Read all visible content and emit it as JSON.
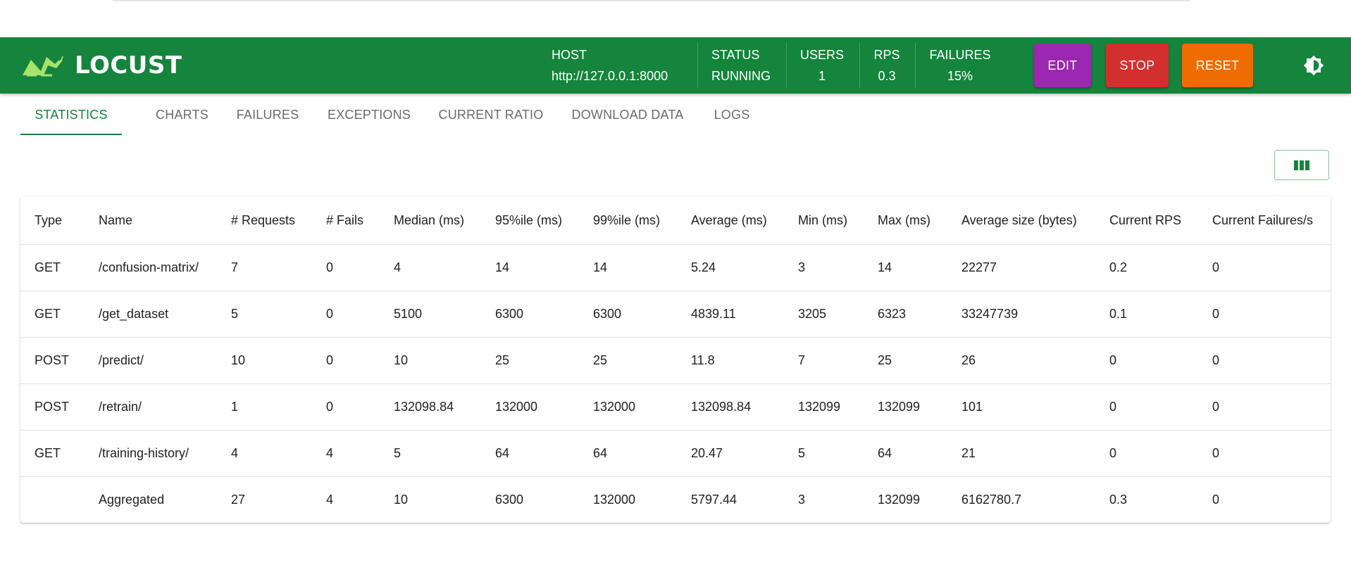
{
  "app": {
    "logo_text": "LOCUST",
    "brand_color": "#15843c"
  },
  "header": {
    "host_label": "HOST",
    "host_value": "http://127.0.0.1:8000",
    "status_label": "STATUS",
    "status_value": "RUNNING",
    "users_label": "USERS",
    "users_value": "1",
    "rps_label": "RPS",
    "rps_value": "0.3",
    "failures_label": "FAILURES",
    "failures_value": "15%",
    "edit_label": "EDIT",
    "stop_label": "STOP",
    "reset_label": "RESET",
    "edit_color": "#9c27b0",
    "stop_color": "#d32f2f",
    "reset_color": "#ef6c00",
    "theme_icon": "brightness-icon"
  },
  "tabs": [
    {
      "label": "STATISTICS",
      "active": true
    },
    {
      "label": "CHARTS"
    },
    {
      "label": "FAILURES"
    },
    {
      "label": "EXCEPTIONS"
    },
    {
      "label": "CURRENT RATIO"
    },
    {
      "label": "DOWNLOAD DATA"
    },
    {
      "label": "LOGS"
    }
  ],
  "toolbar": {
    "columns_icon": "view-column-icon"
  },
  "table": {
    "headers": [
      "Type",
      "Name",
      "# Requests",
      "# Fails",
      "Median (ms)",
      "95%ile (ms)",
      "99%ile (ms)",
      "Average (ms)",
      "Min (ms)",
      "Max (ms)",
      "Average size (bytes)",
      "Current RPS",
      "Current Failures/s"
    ],
    "rows": [
      [
        "GET",
        "/confusion-matrix/",
        "7",
        "0",
        "4",
        "14",
        "14",
        "5.24",
        "3",
        "14",
        "22277",
        "0.2",
        "0"
      ],
      [
        "GET",
        "/get_dataset",
        "5",
        "0",
        "5100",
        "6300",
        "6300",
        "4839.11",
        "3205",
        "6323",
        "33247739",
        "0.1",
        "0"
      ],
      [
        "POST",
        "/predict/",
        "10",
        "0",
        "10",
        "25",
        "25",
        "11.8",
        "7",
        "25",
        "26",
        "0",
        "0"
      ],
      [
        "POST",
        "/retrain/",
        "1",
        "0",
        "132098.84",
        "132000",
        "132000",
        "132098.84",
        "132099",
        "132099",
        "101",
        "0",
        "0"
      ],
      [
        "GET",
        "/training-history/",
        "4",
        "4",
        "5",
        "64",
        "64",
        "20.47",
        "5",
        "64",
        "21",
        "0",
        "0"
      ],
      [
        "",
        "Aggregated",
        "27",
        "4",
        "10",
        "6300",
        "132000",
        "5797.44",
        "3",
        "132099",
        "6162780.7",
        "0.3",
        "0"
      ]
    ]
  }
}
